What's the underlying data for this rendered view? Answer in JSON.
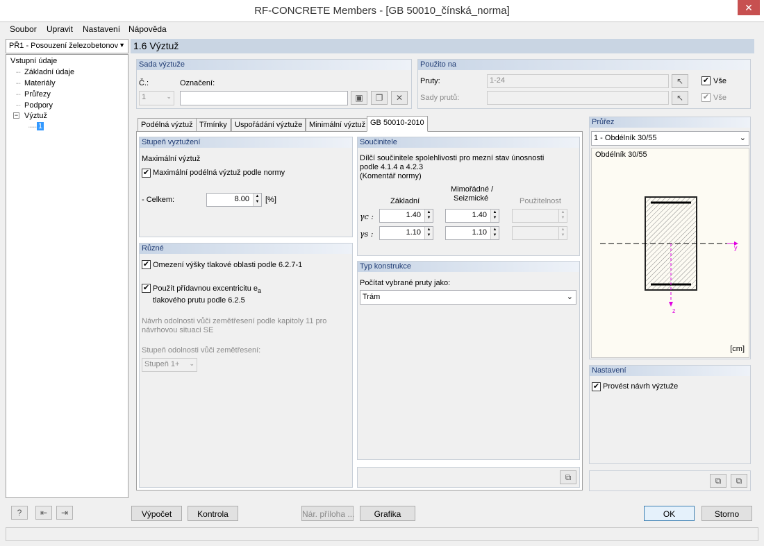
{
  "window": {
    "title": "RF-CONCRETE Members - [GB 50010_čínská_norma]",
    "close": "✕"
  },
  "menu": [
    "Soubor",
    "Upravit",
    "Nastavení",
    "Nápověda"
  ],
  "tree": {
    "combo": "PŘ1 - Posouzení železobetonov",
    "items": [
      "Vstupní údaje",
      "Základní údaje",
      "Materiály",
      "Průřezy",
      "Podpory",
      "Výztuž",
      "1"
    ]
  },
  "header": {
    "title": "1.6 Výztuž"
  },
  "sada": {
    "title": "Sada výztuže",
    "c_label": "Č.:",
    "c_value": "1",
    "oznaceni_label": "Označení:",
    "oznaceni_value": ""
  },
  "pouzito": {
    "title": "Použito na",
    "pruty_label": "Pruty:",
    "pruty_value": "1-24",
    "vse1": "Vše",
    "sady_label": "Sady prutů:",
    "vse2": "Vše"
  },
  "tabs": [
    "Podélná výztuž",
    "Třmínky",
    "Uspořádání výztuže",
    "Minimální výztuž",
    "GB 50010-2010"
  ],
  "stupen": {
    "title": "Stupeň vyztužení",
    "max_label": "Maximální výztuž",
    "max_check": "Maximální podélná výztuž podle normy",
    "celkem_label": "- Celkem:",
    "celkem_value": "8.00",
    "unit": "[%]"
  },
  "ruzne": {
    "title": "Různé",
    "check1": "Omezení výšky tlakové oblasti podle 6.2.7-1",
    "check2a": "Použít přídavnou excentricitu e",
    "check2sub": "a",
    "check2b": "tlakového prutu podle 6.2.5",
    "note1": "Návrh odolnosti vůči zemětřesení podle kapitoly 11 pro",
    "note2": "návrhovou situaci SE",
    "stupen_label": "Stupeň odolnosti vůči zemětřesení:",
    "stupen_value": "Stupeň 1+"
  },
  "soucinitele": {
    "title": "Součinitele",
    "desc1": "Dílčí součinitele spolehlivosti pro mezní stav únosnosti",
    "desc2": "podle 4.1.4 a 4.2.3",
    "desc3": "(Komentář normy)",
    "col1": "Základní",
    "col2a": "Mimořádné /",
    "col2b": "Seizmické",
    "col3": "Použitelnost",
    "gc_label": "γc :",
    "gs_label": "γs :",
    "gc_zakl": "1.40",
    "gc_mim": "1.40",
    "gs_zakl": "1.10",
    "gs_mim": "1.10"
  },
  "typ": {
    "title": "Typ konstrukce",
    "label": "Počítat vybrané pruty jako:",
    "value": "Trám"
  },
  "prurez": {
    "title": "Průřez",
    "combo": "1 - Obdélník 30/55",
    "name": "Obdélník 30/55",
    "unit": "[cm]",
    "y": "y",
    "z": "z"
  },
  "nastaveni": {
    "title": "Nastavení",
    "check": "Provést návrh výztuže"
  },
  "buttons": {
    "vypocet": "Výpočet",
    "kontrola": "Kontrola",
    "nar": "Nár. příloha ...",
    "grafika": "Grafika",
    "ok": "OK",
    "storno": "Storno"
  }
}
